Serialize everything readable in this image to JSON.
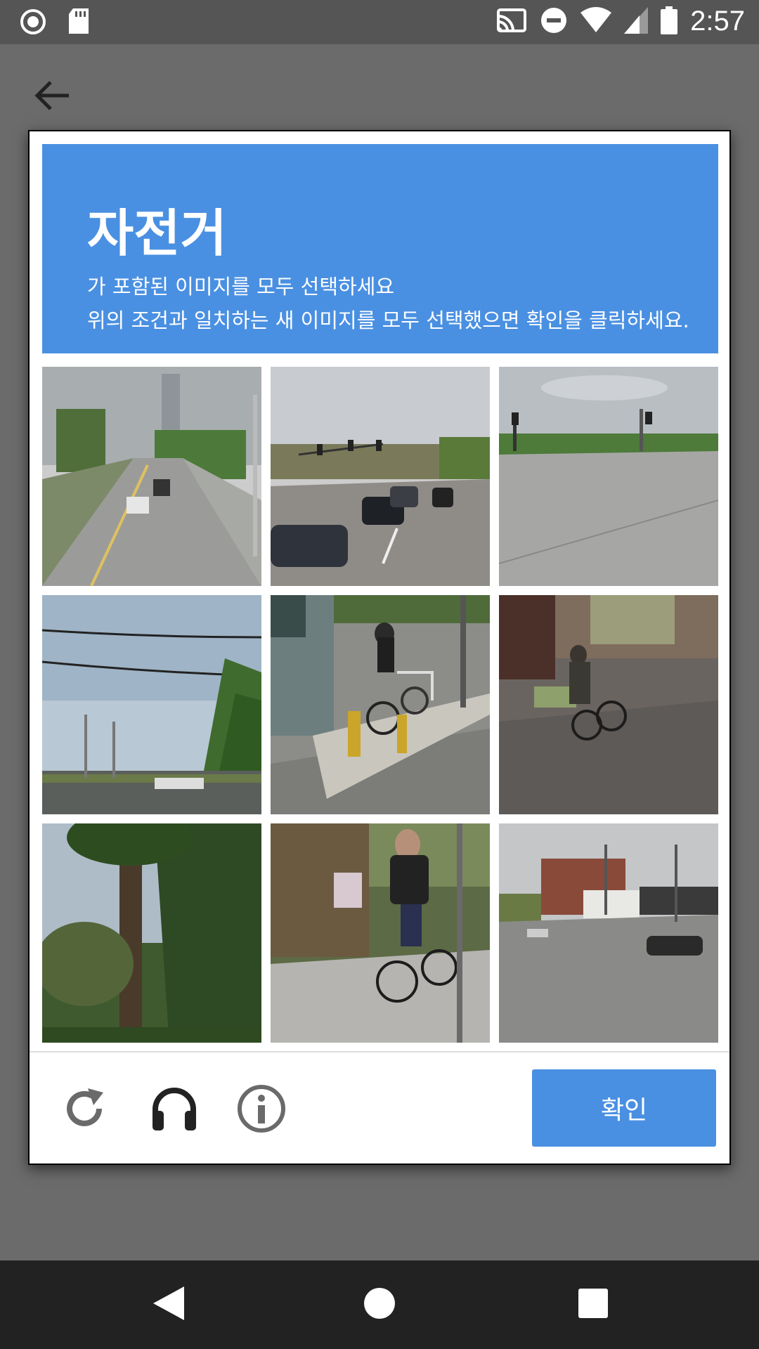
{
  "status_bar": {
    "time": "2:57",
    "left_icons": [
      "record-icon",
      "sd-card-icon"
    ],
    "right_icons": [
      "cast-icon",
      "do-not-disturb-icon",
      "wifi-icon",
      "cell-signal-icon",
      "battery-icon"
    ]
  },
  "navigation": {
    "back_icon": "arrow-back-icon"
  },
  "captcha": {
    "header": {
      "title": "자전거",
      "instruction": "가 포함된 이미지를 모두 선택하세요",
      "sub_instruction": "위의 조건과 일치하는 새 이미지를 모두 선택했으면 확인을 클릭하세요."
    },
    "tiles": [
      {
        "subject": "road-with-cars"
      },
      {
        "subject": "intersection-traffic"
      },
      {
        "subject": "empty-intersection"
      },
      {
        "subject": "power-lines-trees"
      },
      {
        "subject": "bike-rack-sidewalk"
      },
      {
        "subject": "person-on-bicycle"
      },
      {
        "subject": "palm-tree"
      },
      {
        "subject": "man-with-bicycle"
      },
      {
        "subject": "street-corner"
      }
    ],
    "footer": {
      "icons": [
        "reload-icon",
        "headphones-icon",
        "info-icon"
      ],
      "verify_label": "확인"
    }
  },
  "colors": {
    "accent": "#4a90e2",
    "overlay": "#6b6b6b",
    "status_bar": "#555555",
    "nav_bar": "#222222"
  },
  "system_nav": {
    "icons": [
      "back-triangle-icon",
      "home-circle-icon",
      "recents-square-icon"
    ]
  }
}
